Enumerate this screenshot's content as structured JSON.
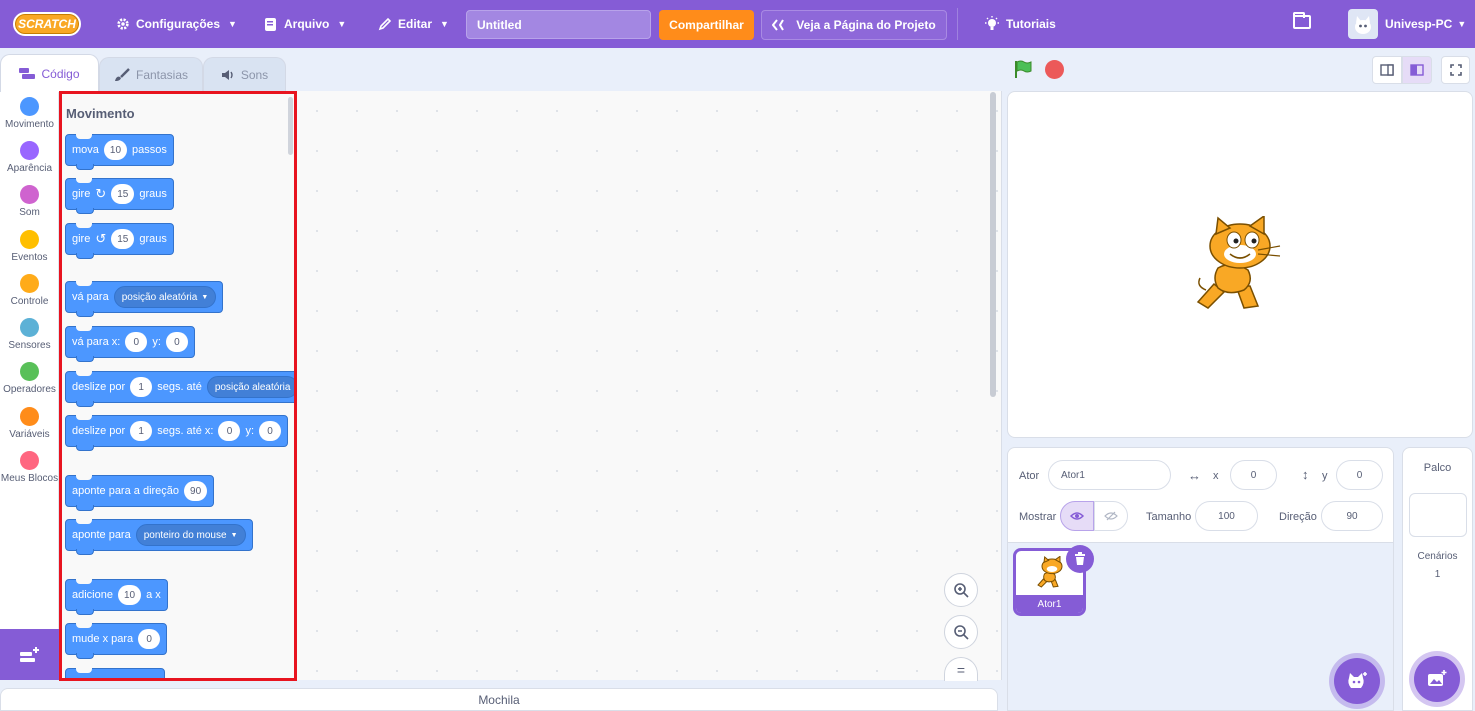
{
  "menubar": {
    "logo": "SCRATCH",
    "settings": "Configurações",
    "file": "Arquivo",
    "edit": "Editar",
    "project_title": "Untitled",
    "share": "Compartilhar",
    "project_page": "Veja a Página do Projeto",
    "tutorials": "Tutoriais",
    "user": "Univesp-PC"
  },
  "tabs": {
    "code": "Código",
    "costumes": "Fantasias",
    "sounds": "Sons"
  },
  "categories": [
    {
      "label": "Movimento",
      "color": "#4c97ff"
    },
    {
      "label": "Aparência",
      "color": "#9966ff"
    },
    {
      "label": "Som",
      "color": "#cf63cf"
    },
    {
      "label": "Eventos",
      "color": "#ffbf00"
    },
    {
      "label": "Controle",
      "color": "#ffab19"
    },
    {
      "label": "Sensores",
      "color": "#5cb1d6"
    },
    {
      "label": "Operadores",
      "color": "#59c059"
    },
    {
      "label": "Variáveis",
      "color": "#ff8c1a"
    },
    {
      "label": "Meus Blocos",
      "color": "#ff6680"
    }
  ],
  "palette": {
    "title": "Movimento",
    "move": {
      "a": "mova",
      "n": "10",
      "b": "passos"
    },
    "turn_right": {
      "a": "gire",
      "n": "15",
      "b": "graus"
    },
    "turn_left": {
      "a": "gire",
      "n": "15",
      "b": "graus"
    },
    "goto": {
      "a": "vá para",
      "d": "posição aleatória"
    },
    "goto_xy": {
      "a": "vá para x:",
      "x": "0",
      "b": "y:",
      "y": "0"
    },
    "glide": {
      "a": "deslize por",
      "n": "1",
      "b": "segs. até",
      "d": "posição aleatória"
    },
    "glide_xy": {
      "a": "deslize por",
      "n": "1",
      "b": "segs. até x:",
      "x": "0",
      "c": "y:",
      "y": "0"
    },
    "point_dir": {
      "a": "aponte para a direção",
      "n": "90"
    },
    "point_to": {
      "a": "aponte para",
      "d": "ponteiro do mouse"
    },
    "change_x": {
      "a": "adicione",
      "n": "10",
      "b": "a x"
    },
    "set_x": {
      "a": "mude x para",
      "n": "0"
    }
  },
  "backpack": "Mochila",
  "sprite_info": {
    "sprite_label": "Ator",
    "sprite_name": "Ator1",
    "x_label": "x",
    "x": "0",
    "y_label": "y",
    "y": "0",
    "show_label": "Mostrar",
    "size_label": "Tamanho",
    "size": "100",
    "direction_label": "Direção",
    "direction": "90"
  },
  "sprite_card": "Ator1",
  "stage_panel": {
    "title": "Palco",
    "backdrops_label": "Cenários",
    "backdrops_count": "1"
  }
}
